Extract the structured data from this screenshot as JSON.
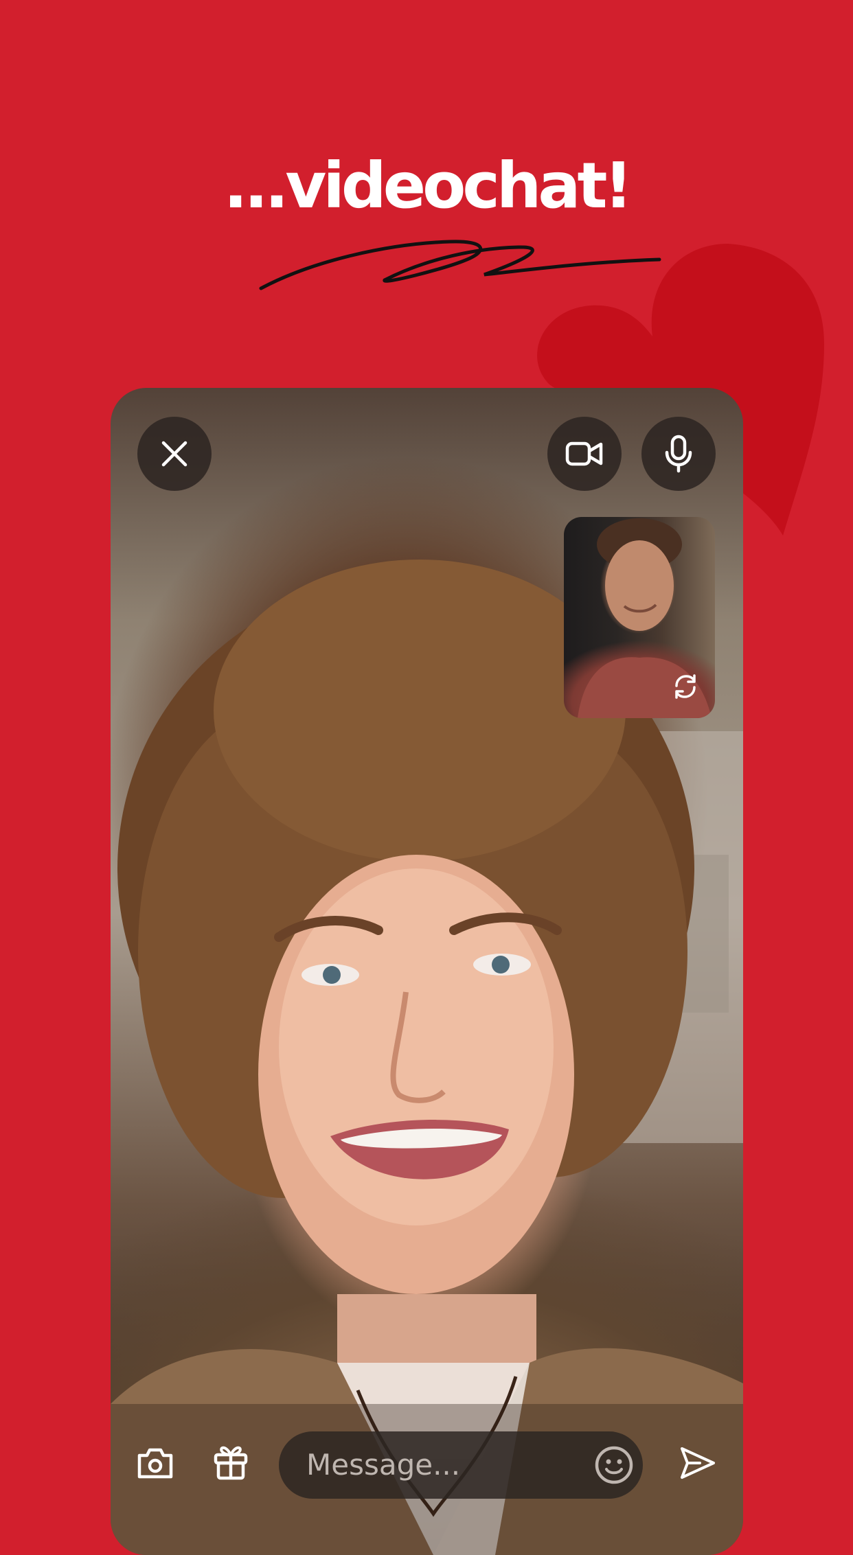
{
  "headline": "...videochat!",
  "controls": {
    "close_icon": "close-icon",
    "camera_icon": "video-camera-icon",
    "mic_icon": "microphone-icon",
    "switch_icon": "switch-camera-icon"
  },
  "message_bar": {
    "placeholder": "Message...",
    "photo_icon": "camera-icon",
    "gift_icon": "gift-icon",
    "emoji_icon": "emoji-icon",
    "send_icon": "send-icon"
  },
  "colors": {
    "background": "#d21f2d",
    "heart": "#c40f1b",
    "button_bg": "#2d2622"
  }
}
